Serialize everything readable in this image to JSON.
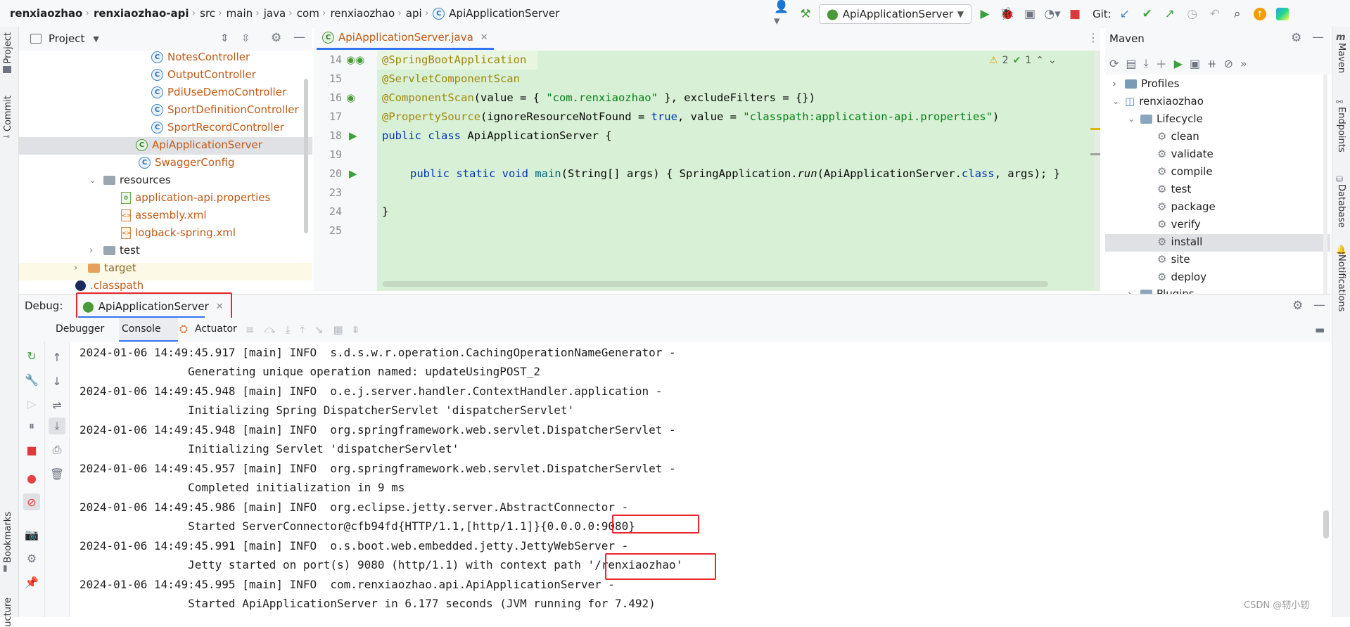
{
  "breadcrumb": [
    "renxiaozhao",
    "renxiaozhao-api",
    "src",
    "main",
    "java",
    "com",
    "renxiaozhao",
    "api",
    "ApiApplicationServer"
  ],
  "run_config": "ApiApplicationServer",
  "git_label": "Git:",
  "left_strip": {
    "project": "Project",
    "commit": "Commit",
    "bookmarks": "Bookmarks",
    "structure": "ucture"
  },
  "project_panel": {
    "title": "Project",
    "items": [
      {
        "label": "NotesController",
        "type": "class",
        "indent": 0
      },
      {
        "label": "OutputController",
        "type": "class"
      },
      {
        "label": "PdiUseDemoController",
        "type": "class"
      },
      {
        "label": "SportDefinitionController",
        "type": "class"
      },
      {
        "label": "SportRecordController",
        "type": "class"
      },
      {
        "label": "ApiApplicationServer",
        "type": "boot-class"
      },
      {
        "label": "SwaggerConfig",
        "type": "class"
      },
      {
        "label": "resources",
        "type": "folder"
      },
      {
        "label": "application-api.properties",
        "type": "props"
      },
      {
        "label": "assembly.xml",
        "type": "xml"
      },
      {
        "label": "logback-spring.xml",
        "type": "xml"
      },
      {
        "label": "test",
        "type": "folder"
      },
      {
        "label": "target",
        "type": "folder"
      },
      {
        "label": ".classpath",
        "type": "file"
      }
    ]
  },
  "editor": {
    "tab": "ApiApplicationServer.java",
    "warnings": "2",
    "ok": "1",
    "line_numbers": [
      "14",
      "15",
      "16",
      "17",
      "18",
      "19",
      "20",
      "23",
      "24",
      "25"
    ],
    "lines": {
      "l14": "@SpringBootApplication",
      "l15": "@ServletComponentScan",
      "l16a": "@ComponentScan",
      "l16b": "(value = { ",
      "l16c": "\"com.renxiaozhao\"",
      "l16d": " }, excludeFilters = {})",
      "l17a": "@PropertySource",
      "l17b": "(ignoreResourceNotFound = ",
      "l17c": "true",
      "l17d": ", value = ",
      "l17e": "\"classpath:application-api.properties\"",
      "l17f": ")",
      "l18a": "public class ",
      "l18b": "ApiApplicationServer {",
      "l20a": "public static void ",
      "l20b": "main",
      "l20c": "(String[] args) { SpringApplication.",
      "l20d": "run",
      "l20e": "(ApiApplicationServer.",
      "l20f": "class",
      "l20g": ", args); }",
      "l24": "}"
    }
  },
  "maven": {
    "title": "Maven",
    "profiles": "Profiles",
    "project": "renxiaozhao",
    "lifecycle": "Lifecycle",
    "goals": [
      "clean",
      "validate",
      "compile",
      "test",
      "package",
      "verify",
      "install",
      "site",
      "deploy"
    ],
    "selected": "install",
    "partial": "Plugins"
  },
  "right_strip": {
    "maven": "Maven",
    "endpoints": "Endpoints",
    "database": "Database",
    "notifications": "Notifications"
  },
  "debug": {
    "label": "Debug:",
    "session": "ApiApplicationServer",
    "tabs": [
      "Debugger",
      "Console",
      "Actuator"
    ],
    "active_tab": "Console"
  },
  "console": [
    "2024-01-06 14:49:45.917 [main] INFO  s.d.s.w.r.operation.CachingOperationNameGenerator -",
    "                Generating unique operation named: updateUsingPOST_2",
    "2024-01-06 14:49:45.948 [main] INFO  o.e.j.server.handler.ContextHandler.application -",
    "                Initializing Spring DispatcherServlet 'dispatcherServlet'",
    "2024-01-06 14:49:45.948 [main] INFO  org.springframework.web.servlet.DispatcherServlet -",
    "                Initializing Servlet 'dispatcherServlet'",
    "2024-01-06 14:49:45.957 [main] INFO  org.springframework.web.servlet.DispatcherServlet -",
    "                Completed initialization in 9 ms",
    "2024-01-06 14:49:45.986 [main] INFO  org.eclipse.jetty.server.AbstractConnector -",
    "                Started ServerConnector@cfb94fd{HTTP/1.1,[http/1.1]}{0.0.0.0:9080}",
    "2024-01-06 14:49:45.991 [main] INFO  o.s.boot.web.embedded.jetty.JettyWebServer -",
    "                Jetty started on port(s) 9080 (http/1.1) with context path '/renxiaozhao'",
    "2024-01-06 14:49:45.995 [main] INFO  com.renxiaozhao.api.ApiApplicationServer -",
    "                Started ApiApplicationServer in 6.177 seconds (JVM running for 7.492)"
  ],
  "watermark": "CSDN @轫小轫"
}
